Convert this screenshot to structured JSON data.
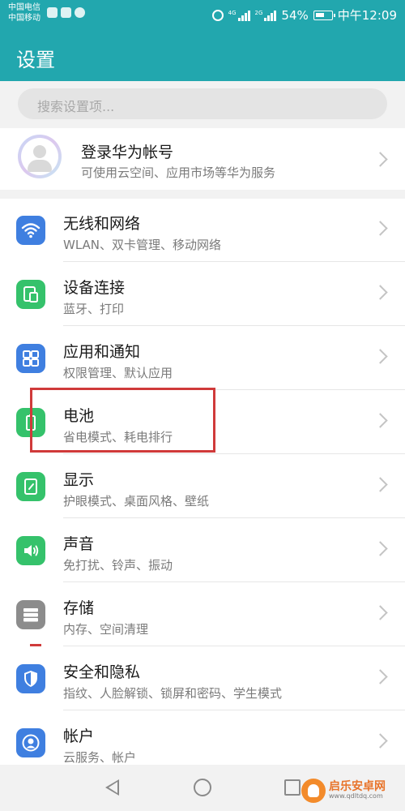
{
  "status_bar": {
    "carrier_1": "中国电信",
    "carrier_2": "中国移动",
    "net_1": "4G",
    "net_2": "2G",
    "battery": "54%",
    "time": "中午12:09"
  },
  "header": {
    "title": "设置"
  },
  "search": {
    "placeholder": "搜索设置项..."
  },
  "account": {
    "title": "登录华为帐号",
    "subtitle": "可使用云空间、应用市场等华为服务"
  },
  "items": [
    {
      "title": "无线和网络",
      "subtitle": "WLAN、双卡管理、移动网络",
      "icon": "wifi-icon",
      "color": "#3f7fe0"
    },
    {
      "title": "设备连接",
      "subtitle": "蓝牙、打印",
      "icon": "device-connection-icon",
      "color": "#35c26b"
    },
    {
      "title": "应用和通知",
      "subtitle": "权限管理、默认应用",
      "icon": "apps-grid-icon",
      "color": "#3f7fe0"
    },
    {
      "title": "电池",
      "subtitle": "省电模式、耗电排行",
      "icon": "battery-icon",
      "color": "#35c26b"
    },
    {
      "title": "显示",
      "subtitle": "护眼模式、桌面风格、壁纸",
      "icon": "display-icon",
      "color": "#35c26b"
    },
    {
      "title": "声音",
      "subtitle": "免打扰、铃声、振动",
      "icon": "speaker-icon",
      "color": "#35c26b"
    },
    {
      "title": "存储",
      "subtitle": "内存、空间清理",
      "icon": "storage-icon",
      "color": "#8c8c8c"
    },
    {
      "title": "安全和隐私",
      "subtitle": "指纹、人脸解锁、锁屏和密码、学生模式",
      "icon": "shield-icon",
      "color": "#3f7fe0"
    },
    {
      "title": "帐户",
      "subtitle": "云服务、帐户",
      "icon": "account-icon",
      "color": "#3f7fe0"
    }
  ],
  "watermark": {
    "name": "启乐安卓网",
    "url": "www.qdltdq.com"
  },
  "colors": {
    "appbar": "#22a7ae",
    "highlight": "#d03a3a"
  }
}
